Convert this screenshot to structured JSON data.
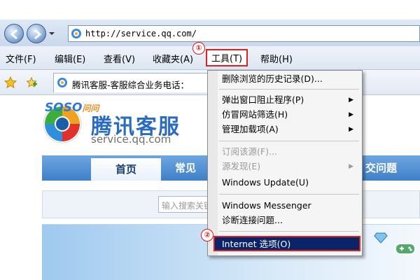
{
  "address_bar": {
    "url": "http://service.qq.com/"
  },
  "menu": {
    "items": [
      {
        "label": "文件(F)"
      },
      {
        "label": "编辑(E)"
      },
      {
        "label": "查看(V)"
      },
      {
        "label": "收藏夹(A)"
      },
      {
        "label": "工具(T)"
      },
      {
        "label": "帮助(H)"
      }
    ],
    "callout_1": "①",
    "callout_2": "②"
  },
  "favorites_bar": {
    "tab_title": "腾讯客服-客服综合业务电话："
  },
  "page": {
    "brand_title": "腾讯客服",
    "brand_url": "service.qq.com",
    "nav_home": "首页",
    "nav_common": "常见",
    "nav_faq": "交问题",
    "search_brand": "SOSO",
    "search_brand_suffix": "问问",
    "search_placeholder": "输入搜索关键词"
  },
  "tools_menu": {
    "items": [
      {
        "label": "删除浏览的历史记录(D)...",
        "enabled": true,
        "submenu": false
      },
      {
        "label": "弹出窗口阻止程序(P)",
        "enabled": true,
        "submenu": true
      },
      {
        "label": "仿冒网站筛选(H)",
        "enabled": true,
        "submenu": true
      },
      {
        "label": "管理加载项(A)",
        "enabled": true,
        "submenu": true
      },
      {
        "label": "订阅该源(F)...",
        "enabled": false,
        "submenu": false
      },
      {
        "label": "源发现(E)",
        "enabled": false,
        "submenu": true
      },
      {
        "label": "Windows Update(U)",
        "enabled": true,
        "submenu": false
      },
      {
        "label": "Windows Messenger",
        "enabled": true,
        "submenu": false
      },
      {
        "label": "诊断连接问题...",
        "enabled": true,
        "submenu": false
      },
      {
        "label": "Internet 选项(O)",
        "enabled": true,
        "submenu": false,
        "selected": true
      }
    ],
    "submenu_arrow": "▶"
  },
  "colors": {
    "highlight_red": "#e02020",
    "selection_blue": "#0a246a",
    "brand_blue": "#2a6cc0"
  }
}
